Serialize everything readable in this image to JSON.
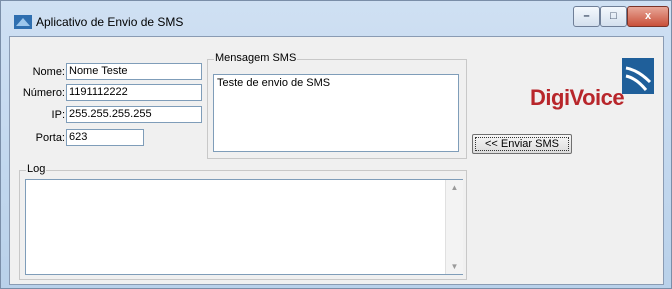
{
  "window": {
    "title": "Aplicativo de Envio de SMS"
  },
  "window_controls": {
    "minimize": "–",
    "maximize": "□",
    "close": "x"
  },
  "form": {
    "nome": {
      "label": "Nome:",
      "value": "Nome Teste"
    },
    "numero": {
      "label": "Número:",
      "value": "1191112222"
    },
    "ip": {
      "label": "IP:",
      "value": "255.255.255.255"
    },
    "porta": {
      "label": "Porta:",
      "value": "623"
    }
  },
  "message": {
    "group_label": "Mensagem SMS",
    "text": "Teste de envio de SMS"
  },
  "send_button": {
    "label": "<< Enviar SMS"
  },
  "log": {
    "group_label": "Log",
    "text": ""
  },
  "logo": {
    "text": "DigiVoice",
    "color": "#b8262b",
    "mark_color": "#1f5f9a"
  }
}
